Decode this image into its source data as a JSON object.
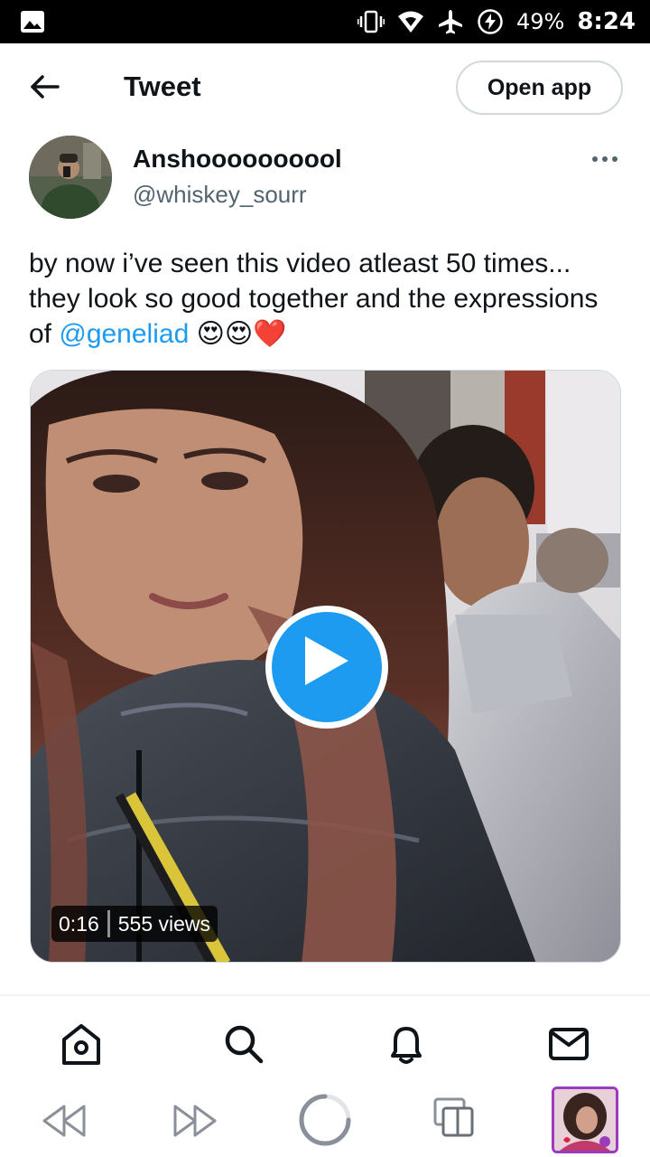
{
  "status_bar": {
    "battery_percent": "49%",
    "time": "8:24",
    "icons": [
      "gallery-icon",
      "vibrate-icon",
      "wifi-icon",
      "airplane-mode-icon",
      "battery-charging-icon"
    ]
  },
  "header": {
    "title": "Tweet",
    "open_app_label": "Open app"
  },
  "tweet": {
    "author": {
      "display_name": "Anshoooooooool",
      "handle": "@whiskey_sourr"
    },
    "text_before_mention": "by now i’ve seen this video atleast 50 times... they look so good together and the expressions of ",
    "mention": "@geneliad",
    "text_after_mention": " 😍😍❤️",
    "media": {
      "type": "video",
      "duration": "0:16",
      "views": "555 views"
    }
  },
  "bottom_nav": {
    "items": [
      "home-icon",
      "search-icon",
      "notifications-icon",
      "messages-icon"
    ]
  },
  "browser_toolbar": {
    "items": [
      "back-icon",
      "forward-icon",
      "reload-icon",
      "tabs-icon",
      "profile-thumbnail"
    ]
  },
  "colors": {
    "accent": "#1d9bf0",
    "text": "#0f1419",
    "secondary_text": "#536471",
    "border": "#cfd9de"
  }
}
